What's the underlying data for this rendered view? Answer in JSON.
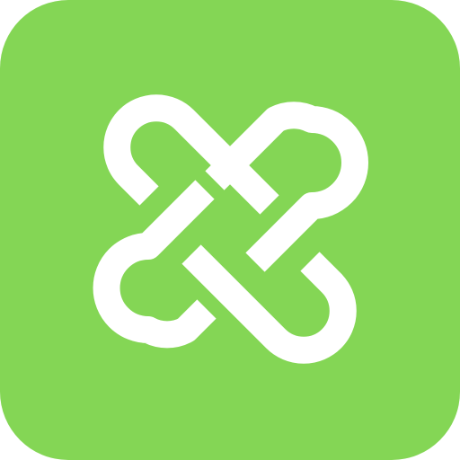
{
  "icon": {
    "name": "interlaced-knot-icon",
    "description_label": "",
    "colors": {
      "background": "#84d655",
      "glyph": "#ffffff"
    }
  }
}
